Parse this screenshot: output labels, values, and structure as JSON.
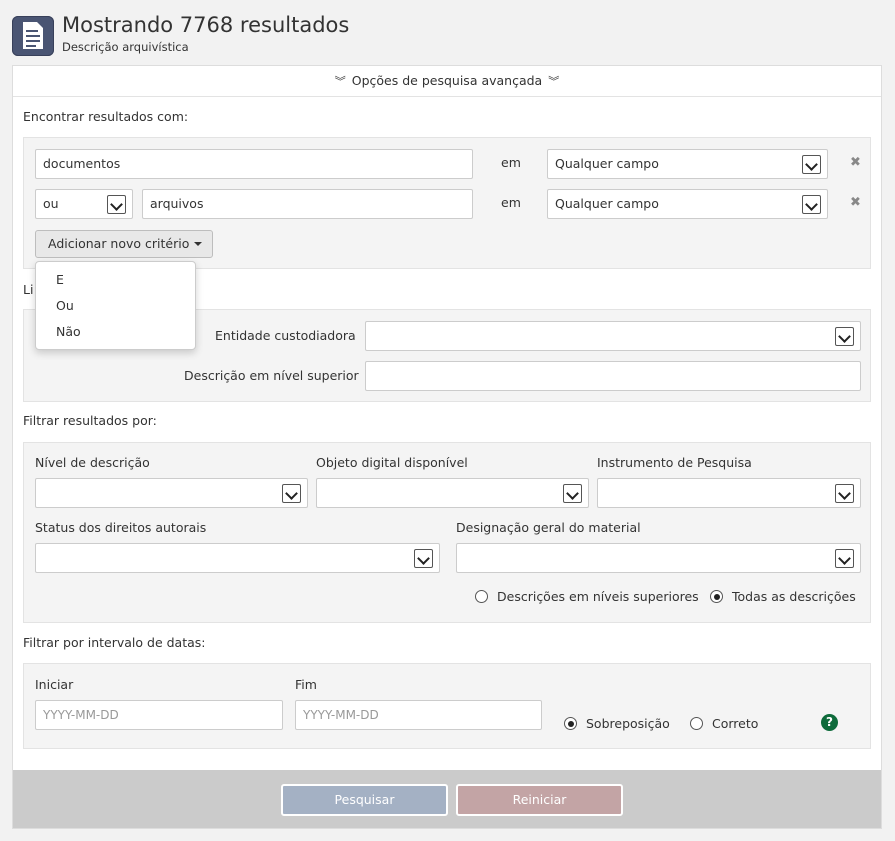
{
  "header": {
    "title": "Mostrando 7768 resultados",
    "subtitle": "Descrição arquivística",
    "icon": "document-icon"
  },
  "advanced_toggle": {
    "label": "Opções de pesquisa avançada",
    "icon": "double-chevron-down-icon"
  },
  "criteria": {
    "heading": "Encontrar resultados com:",
    "rows": [
      {
        "query": "documentos",
        "in_label": "em",
        "field": "Qualquer campo"
      },
      {
        "operator": "ou",
        "query": "arquivos",
        "in_label": "em",
        "field": "Qualquer campo"
      }
    ],
    "remove_icon": "close-icon",
    "add_button": "Adicionar novo critério",
    "add_menu": [
      "E",
      "Ou",
      "Não"
    ]
  },
  "limit": {
    "heading": "Li",
    "repository_label": "Entidade custodiadora",
    "repository_value": "",
    "parent_label": "Descrição em nível superior",
    "parent_value": ""
  },
  "filter": {
    "heading": "Filtrar resultados por:",
    "level_label": "Nível de descrição",
    "digital_label": "Objeto digital disponível",
    "finding_aid_label": "Instrumento de Pesquisa",
    "copyright_label": "Status dos direitos autorais",
    "material_label": "Designação geral do material",
    "radio_top": "Descrições em níveis superiores",
    "radio_all": "Todas as descrições",
    "selected_scope": "all"
  },
  "dates": {
    "heading": "Filtrar por intervalo de datas:",
    "start_label": "Iniciar",
    "start_placeholder": "YYYY-MM-DD",
    "end_label": "Fim",
    "end_placeholder": "YYYY-MM-DD",
    "overlap_label": "Sobreposição",
    "exact_label": "Correto",
    "selected_type": "overlap",
    "help_icon": "?"
  },
  "actions": {
    "search": "Pesquisar",
    "reset": "Reiniciar"
  },
  "colors": {
    "search_button": "#a4b1c4",
    "reset_button": "#c3a4a5",
    "help_icon": "#0e6b3b",
    "header_icon": "#4a5573"
  }
}
